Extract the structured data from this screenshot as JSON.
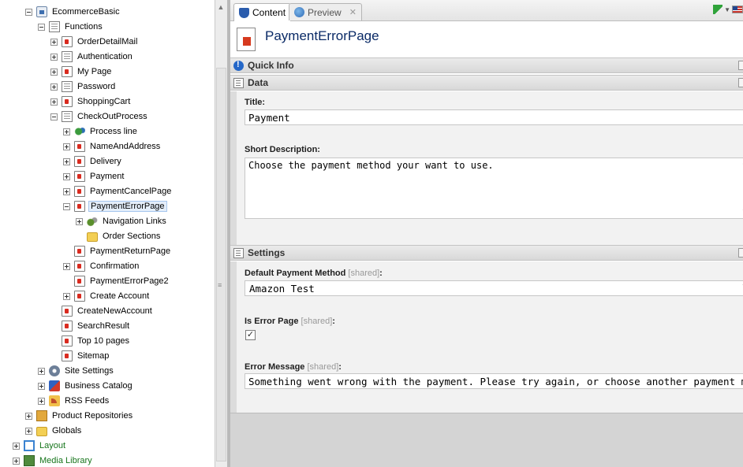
{
  "tree": {
    "nodes": [
      {
        "label": "EcommerceBasic",
        "icon": "home-icon"
      },
      {
        "label": "Functions",
        "icon": "folder-page-icon"
      },
      {
        "label": "OrderDetailMail",
        "icon": "page-icon"
      },
      {
        "label": "Authentication",
        "icon": "folder-page-icon"
      },
      {
        "label": "My Page",
        "icon": "page-icon"
      },
      {
        "label": "Password",
        "icon": "folder-page-icon"
      },
      {
        "label": "ShoppingCart",
        "icon": "page-icon"
      },
      {
        "label": "CheckOutProcess",
        "icon": "folder-page-icon"
      },
      {
        "label": "Process line",
        "icon": "process-icon"
      },
      {
        "label": "NameAndAddress",
        "icon": "page-icon"
      },
      {
        "label": "Delivery",
        "icon": "page-icon"
      },
      {
        "label": "Payment",
        "icon": "page-icon"
      },
      {
        "label": "PaymentCancelPage",
        "icon": "page-icon"
      },
      {
        "label": "PaymentErrorPage",
        "icon": "page-icon",
        "selected": true
      },
      {
        "label": "Navigation Links",
        "icon": "navigation-icon"
      },
      {
        "label": "Order Sections",
        "icon": "folder-icon"
      },
      {
        "label": "PaymentReturnPage",
        "icon": "page-icon"
      },
      {
        "label": "Confirmation",
        "icon": "page-icon"
      },
      {
        "label": "PaymentErrorPage2",
        "icon": "page-icon"
      },
      {
        "label": "Create Account",
        "icon": "page-icon"
      },
      {
        "label": "CreateNewAccount",
        "icon": "page-icon"
      },
      {
        "label": "SearchResult",
        "icon": "page-icon"
      },
      {
        "label": "Top 10 pages",
        "icon": "page-icon"
      },
      {
        "label": "Sitemap",
        "icon": "page-icon"
      },
      {
        "label": "Site Settings",
        "icon": "gear-icon"
      },
      {
        "label": "Business Catalog",
        "icon": "catalog-icon"
      },
      {
        "label": "RSS Feeds",
        "icon": "rss-icon"
      },
      {
        "label": "Product Repositories",
        "icon": "box-icon"
      },
      {
        "label": "Globals",
        "icon": "folder-icon"
      },
      {
        "label": "Layout",
        "icon": "layout-icon"
      },
      {
        "label": "Media Library",
        "icon": "media-icon"
      }
    ]
  },
  "tabs": {
    "content": "Content",
    "preview": "Preview",
    "close_glyph": "✕"
  },
  "page": {
    "title": "PaymentErrorPage"
  },
  "sections": {
    "quick_info": "Quick Info",
    "data": "Data",
    "settings": "Settings"
  },
  "fields": {
    "title_label": "Title:",
    "title_value": "Payment",
    "short_desc_label": "Short Description:",
    "short_desc_value": "Choose the payment method your want to use.",
    "payment_method_label": "Default Payment Method",
    "payment_method_value": "Amazon Test",
    "is_error_label": "Is Error Page",
    "is_error_checked": true,
    "error_msg_label": "Error Message",
    "error_msg_value": "Something went wrong with the payment. Please try again, or choose another payment metho",
    "shared_tag": "[shared]",
    "colon": ":"
  }
}
